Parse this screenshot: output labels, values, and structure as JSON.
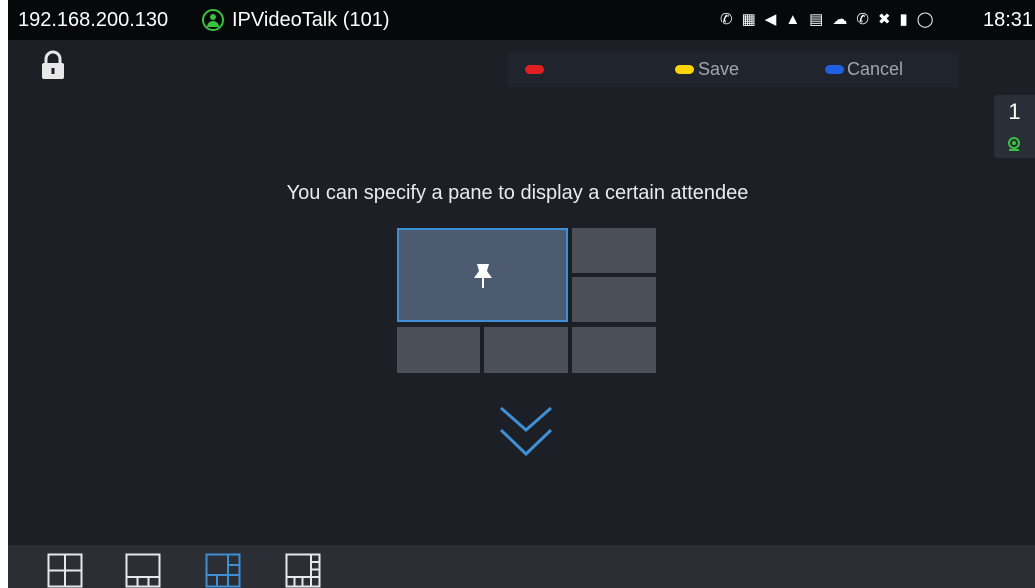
{
  "status_bar": {
    "ip_address": "192.168.200.130",
    "app_name": "IPVideoTalk (101)",
    "time": "18:31",
    "icons": [
      "call-forward-icon",
      "calendar-icon",
      "volume-icon",
      "signal-icon",
      "sim-card-icon",
      "cloud-icon",
      "call-icon",
      "mute-icon",
      "battery-icon",
      "sync-icon"
    ]
  },
  "action_bar": {
    "red_key_label": "",
    "save_label": "Save",
    "cancel_label": "Cancel",
    "colors": {
      "red": "#e02020",
      "yellow": "#ffd200",
      "blue": "#1f5fe0"
    }
  },
  "side_panel": {
    "count": "1",
    "icon": "camera-icon"
  },
  "main": {
    "instruction": "You can specify a pane to display a certain attendee",
    "selected_pane": "main-pane",
    "pin_icon": "pin-icon",
    "hint_icon": "double-chevron-down-icon"
  },
  "layouts": [
    {
      "name": "layout-grid-2x2",
      "selected": false
    },
    {
      "name": "layout-1-plus-3-bottom",
      "selected": false
    },
    {
      "name": "layout-1-plus-5",
      "selected": true
    },
    {
      "name": "layout-1-plus-7",
      "selected": false
    }
  ],
  "colors": {
    "accent": "#3f8fd6",
    "background": "#1c1f26",
    "status_green": "#38c23e"
  }
}
